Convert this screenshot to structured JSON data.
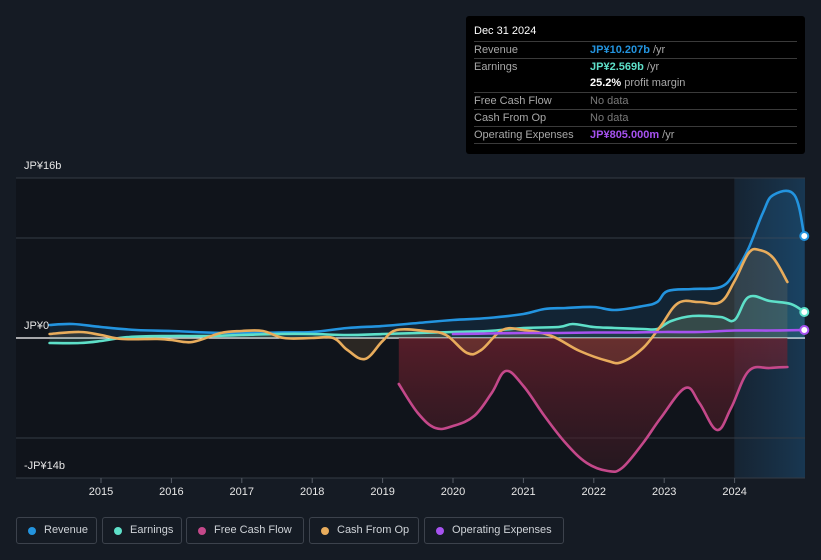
{
  "tooltip": {
    "date": "Dec 31 2024",
    "rows": [
      {
        "key": "Revenue",
        "value": "JP¥10.207b",
        "unit": " /yr",
        "color": "#2394df"
      },
      {
        "key": "Earnings",
        "value": "JP¥2.569b",
        "unit": " /yr",
        "color": "#5ee0c9"
      },
      {
        "key": "",
        "value": "25.2%",
        "unit": " profit margin",
        "color": "#ffffff"
      },
      {
        "key": "Free Cash Flow",
        "value": "No data",
        "unit": "",
        "color": "#7a7a7a"
      },
      {
        "key": "Cash From Op",
        "value": "No data",
        "unit": "",
        "color": "#7a7a7a"
      },
      {
        "key": "Operating Expenses",
        "value": "JP¥805.000m",
        "unit": " /yr",
        "color": "#a652f0"
      }
    ]
  },
  "legend": [
    {
      "label": "Revenue",
      "color": "#2394df"
    },
    {
      "label": "Earnings",
      "color": "#5ee0c9"
    },
    {
      "label": "Free Cash Flow",
      "color": "#c4488a"
    },
    {
      "label": "Cash From Op",
      "color": "#e8ac5c"
    },
    {
      "label": "Operating Expenses",
      "color": "#a652f0"
    }
  ],
  "chart_data": {
    "type": "line",
    "title": "",
    "xlabel": "",
    "ylabel": "",
    "unit": "JP¥ billions",
    "ylim": [
      -14,
      16
    ],
    "y_tick_labels": [
      {
        "value": 16,
        "label": "JP¥16b"
      },
      {
        "value": 0,
        "label": "JP¥0"
      },
      {
        "value": -14,
        "label": "-JP¥14b"
      }
    ],
    "gridlines": [
      16,
      10,
      0,
      -10,
      -14
    ],
    "x_ticks": [
      2015,
      2016,
      2017,
      2018,
      2019,
      2020,
      2021,
      2022,
      2023,
      2024
    ],
    "xlim": [
      2014.27,
      2024.99
    ],
    "highlight_from": 2024.0,
    "series": [
      {
        "name": "Revenue",
        "color": "#2394df",
        "fill": true,
        "end_dot": true,
        "points": [
          [
            2014.27,
            1.3
          ],
          [
            2014.6,
            1.4
          ],
          [
            2015.0,
            1.1
          ],
          [
            2015.5,
            0.8
          ],
          [
            2016.0,
            0.7
          ],
          [
            2016.5,
            0.55
          ],
          [
            2017.0,
            0.5
          ],
          [
            2017.5,
            0.55
          ],
          [
            2018.0,
            0.6
          ],
          [
            2018.5,
            1.0
          ],
          [
            2019.0,
            1.2
          ],
          [
            2019.5,
            1.5
          ],
          [
            2020.0,
            1.8
          ],
          [
            2020.5,
            2.0
          ],
          [
            2021.0,
            2.4
          ],
          [
            2021.3,
            2.9
          ],
          [
            2021.6,
            3.0
          ],
          [
            2022.0,
            3.1
          ],
          [
            2022.3,
            2.8
          ],
          [
            2022.7,
            3.2
          ],
          [
            2022.9,
            3.6
          ],
          [
            2023.05,
            4.7
          ],
          [
            2023.4,
            4.9
          ],
          [
            2023.8,
            5.1
          ],
          [
            2024.0,
            6.5
          ],
          [
            2024.2,
            9.0
          ],
          [
            2024.4,
            12.5
          ],
          [
            2024.55,
            14.3
          ],
          [
            2024.85,
            14.3
          ],
          [
            2024.99,
            10.2
          ]
        ]
      },
      {
        "name": "Earnings",
        "color": "#5ee0c9",
        "fill": true,
        "end_dot": true,
        "points": [
          [
            2014.27,
            -0.5
          ],
          [
            2014.7,
            -0.5
          ],
          [
            2015.0,
            -0.3
          ],
          [
            2015.4,
            0.1
          ],
          [
            2016.0,
            0.2
          ],
          [
            2016.5,
            0.2
          ],
          [
            2017.0,
            0.3
          ],
          [
            2017.5,
            0.4
          ],
          [
            2018.0,
            0.4
          ],
          [
            2018.5,
            0.3
          ],
          [
            2019.0,
            0.4
          ],
          [
            2019.5,
            0.5
          ],
          [
            2020.0,
            0.6
          ],
          [
            2020.5,
            0.7
          ],
          [
            2021.0,
            1.0
          ],
          [
            2021.5,
            1.1
          ],
          [
            2021.7,
            1.4
          ],
          [
            2022.0,
            1.1
          ],
          [
            2022.3,
            1.0
          ],
          [
            2022.7,
            0.9
          ],
          [
            2022.9,
            0.9
          ],
          [
            2023.1,
            1.7
          ],
          [
            2023.4,
            2.2
          ],
          [
            2023.8,
            2.1
          ],
          [
            2024.0,
            1.8
          ],
          [
            2024.2,
            4.1
          ],
          [
            2024.5,
            3.7
          ],
          [
            2024.8,
            3.4
          ],
          [
            2024.99,
            2.6
          ]
        ]
      },
      {
        "name": "Free Cash Flow",
        "color": "#c4488a",
        "fill": true,
        "end_dot": false,
        "points": [
          [
            2019.23,
            -4.6
          ],
          [
            2019.5,
            -7.5
          ],
          [
            2019.75,
            -9.0
          ],
          [
            2020.0,
            -8.8
          ],
          [
            2020.3,
            -7.8
          ],
          [
            2020.55,
            -5.5
          ],
          [
            2020.75,
            -3.3
          ],
          [
            2021.0,
            -4.8
          ],
          [
            2021.3,
            -7.8
          ],
          [
            2021.6,
            -10.5
          ],
          [
            2021.9,
            -12.5
          ],
          [
            2022.2,
            -13.3
          ],
          [
            2022.4,
            -13.0
          ],
          [
            2022.7,
            -10.5
          ],
          [
            2022.95,
            -8.0
          ],
          [
            2023.3,
            -5.0
          ],
          [
            2023.5,
            -6.5
          ],
          [
            2023.75,
            -9.2
          ],
          [
            2023.95,
            -7.0
          ],
          [
            2024.2,
            -3.3
          ],
          [
            2024.5,
            -3.0
          ],
          [
            2024.75,
            -2.9
          ]
        ]
      },
      {
        "name": "Cash From Op",
        "color": "#e8ac5c",
        "fill": true,
        "end_dot": false,
        "points": [
          [
            2014.27,
            0.4
          ],
          [
            2014.7,
            0.6
          ],
          [
            2015.0,
            0.3
          ],
          [
            2015.3,
            -0.1
          ],
          [
            2015.8,
            -0.1
          ],
          [
            2016.0,
            -0.2
          ],
          [
            2016.3,
            -0.4
          ],
          [
            2016.7,
            0.5
          ],
          [
            2017.0,
            0.7
          ],
          [
            2017.3,
            0.7
          ],
          [
            2017.6,
            0.0
          ],
          [
            2018.0,
            0.0
          ],
          [
            2018.3,
            0.0
          ],
          [
            2018.5,
            -1.2
          ],
          [
            2018.75,
            -2.1
          ],
          [
            2019.0,
            -0.3
          ],
          [
            2019.2,
            0.8
          ],
          [
            2019.6,
            0.7
          ],
          [
            2019.9,
            0.3
          ],
          [
            2020.2,
            -1.5
          ],
          [
            2020.4,
            -1.2
          ],
          [
            2020.7,
            0.8
          ],
          [
            2021.0,
            0.8
          ],
          [
            2021.4,
            0.2
          ],
          [
            2021.8,
            -1.3
          ],
          [
            2022.2,
            -2.3
          ],
          [
            2022.4,
            -2.4
          ],
          [
            2022.7,
            -1.0
          ],
          [
            2022.95,
            1.2
          ],
          [
            2023.2,
            3.5
          ],
          [
            2023.5,
            3.6
          ],
          [
            2023.8,
            3.6
          ],
          [
            2024.0,
            5.7
          ],
          [
            2024.2,
            8.5
          ],
          [
            2024.35,
            8.8
          ],
          [
            2024.55,
            8.0
          ],
          [
            2024.75,
            5.6
          ]
        ]
      },
      {
        "name": "Operating Expenses",
        "color": "#a652f0",
        "fill": false,
        "end_dot": true,
        "points": [
          [
            2020.0,
            0.4
          ],
          [
            2020.5,
            0.45
          ],
          [
            2021.0,
            0.5
          ],
          [
            2021.5,
            0.5
          ],
          [
            2022.0,
            0.55
          ],
          [
            2022.5,
            0.55
          ],
          [
            2023.0,
            0.6
          ],
          [
            2023.5,
            0.6
          ],
          [
            2024.0,
            0.75
          ],
          [
            2024.5,
            0.75
          ],
          [
            2024.99,
            0.8
          ]
        ]
      }
    ]
  }
}
